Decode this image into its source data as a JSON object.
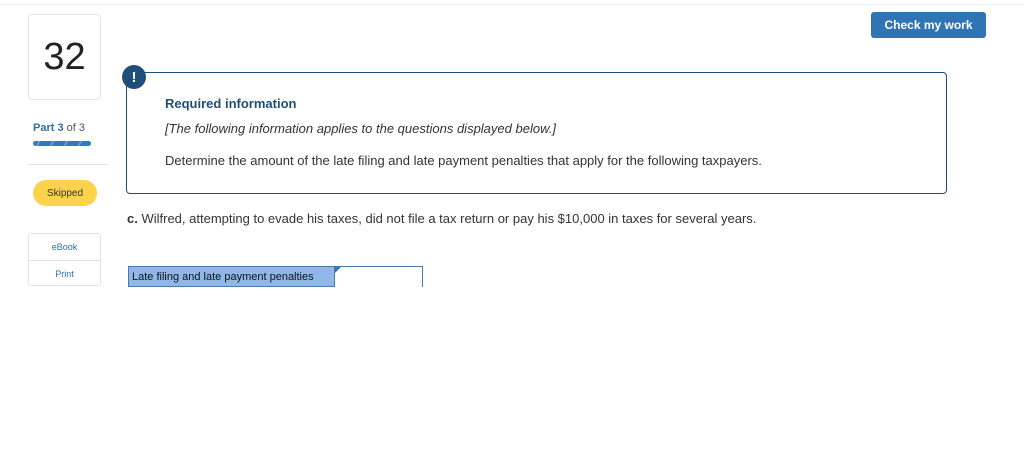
{
  "question": {
    "number": "32",
    "part_label": "Part",
    "part_current": "3",
    "part_of": "of 3",
    "progress_fraction": 1.0,
    "status_badge": "Skipped"
  },
  "tools": [
    {
      "label": "eBook"
    },
    {
      "label": "Print"
    }
  ],
  "header": {
    "check_button": "Check my work"
  },
  "info": {
    "alert_symbol": "!",
    "title": "Required information",
    "note": "[The following information applies to the questions displayed below.]",
    "body": "Determine the amount of the late filing and late payment penalties that apply for the following taxpayers."
  },
  "prompt": {
    "letter": "c.",
    "text": "Wilfred, attempting to evade his taxes, did not file a tax return or pay his $10,000 in taxes for several years."
  },
  "answer": {
    "label": "Late filing and late payment penalties",
    "value": ""
  },
  "colors": {
    "primary": "#2f74b5",
    "dark_blue": "#1f4e79",
    "badge": "#fcd34d",
    "label_cell": "#8fb8e8"
  }
}
